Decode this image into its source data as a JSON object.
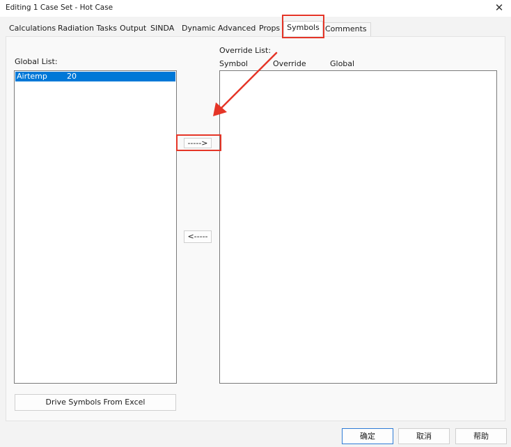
{
  "window": {
    "title": "Editing 1 Case Set - Hot Case",
    "close_glyph": "✕"
  },
  "tabs": [
    {
      "label": "Calculations"
    },
    {
      "label": "Radiation Tasks"
    },
    {
      "label": "Output"
    },
    {
      "label": "SINDA"
    },
    {
      "label": "Dynamic"
    },
    {
      "label": "Advanced"
    },
    {
      "label": "Props"
    },
    {
      "label": "Symbols"
    },
    {
      "label": "Comments"
    }
  ],
  "active_tab": "Symbols",
  "global_list": {
    "label": "Global List:",
    "items": [
      {
        "symbol": "Airtemp",
        "value": "20",
        "selected": true
      }
    ]
  },
  "override_list": {
    "label": "Override List:",
    "columns": [
      "Symbol",
      "Override",
      "Global"
    ],
    "items": []
  },
  "buttons": {
    "move_right": "----->",
    "move_left": "<-----",
    "drive_excel": "Drive Symbols From Excel",
    "ok": "确定",
    "cancel": "取消",
    "help": "帮助"
  },
  "colors": {
    "accent": "#0078d7",
    "annotation": "#e53527",
    "primary_border": "#2e7bd6"
  },
  "icons": {
    "close": "close-icon",
    "annotation_arrow": "arrow-annotation-icon"
  }
}
